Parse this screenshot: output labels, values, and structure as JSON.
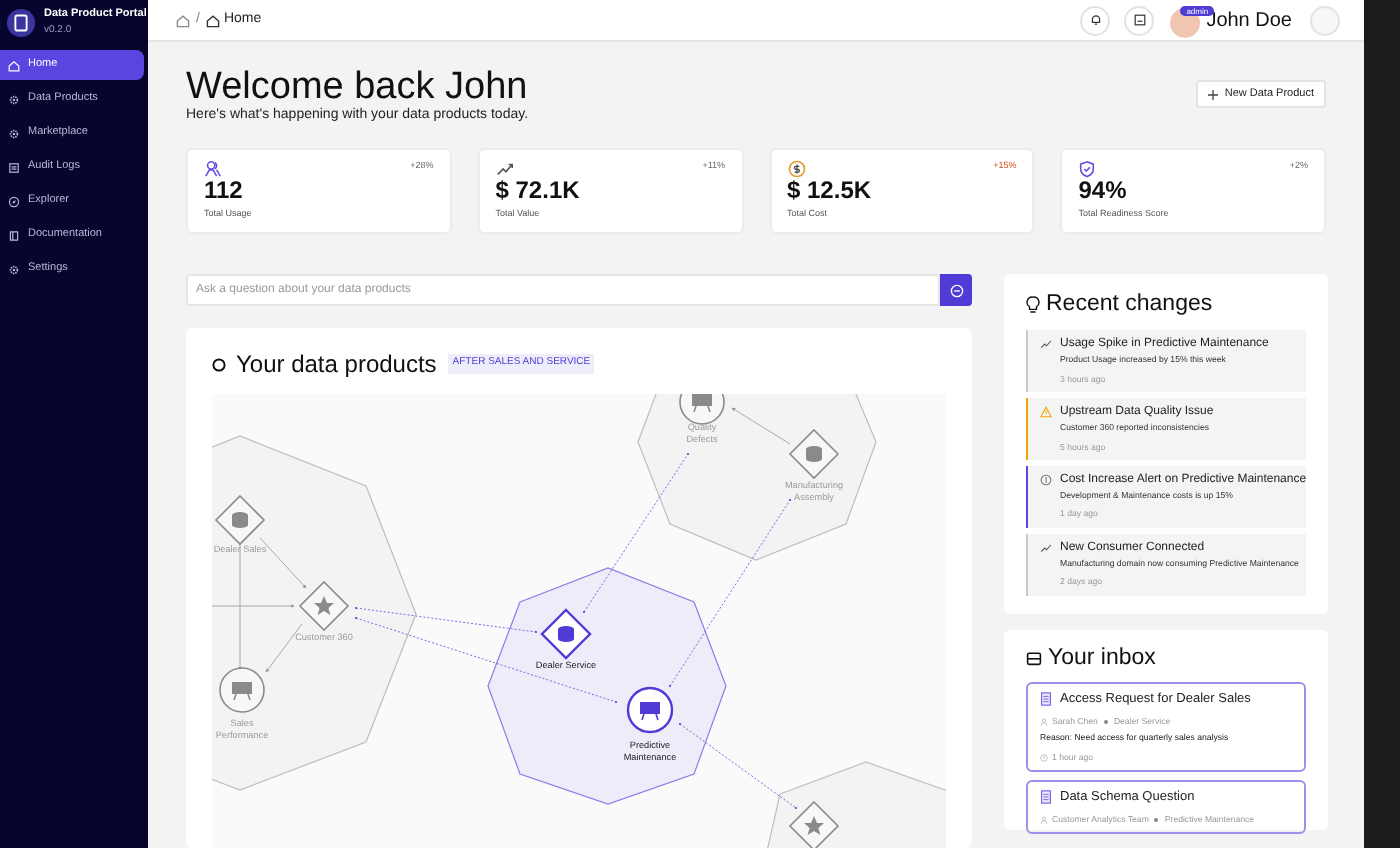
{
  "sidebar": {
    "brand": "Data Product Portal",
    "version": "v0.2.0",
    "items": [
      {
        "label": "Home",
        "selected": true
      },
      {
        "label": "Data Products",
        "selected": false
      },
      {
        "label": "Marketplace",
        "selected": false
      },
      {
        "label": "Audit Logs",
        "selected": false
      },
      {
        "label": "Explorer",
        "selected": false
      },
      {
        "label": "Documentation",
        "selected": false
      },
      {
        "label": "Settings",
        "selected": false
      }
    ]
  },
  "topbar": {
    "breadcrumb_separator": "/",
    "breadcrumb": "Home",
    "user": {
      "name": "John Doe",
      "role": "admin"
    }
  },
  "header": {
    "title": "Welcome back John",
    "subtitle": "Here's what's happening with your data products today.",
    "button": "New Data Product"
  },
  "stats": [
    {
      "kind": "usage",
      "value": "112",
      "label": "Total Usage",
      "change": "+28%"
    },
    {
      "kind": "value",
      "value": "$ 72.1K",
      "label": "Total Value",
      "change": "+11%"
    },
    {
      "kind": "cost",
      "value": "$ 12.5K",
      "label": "Total Cost",
      "change": "+15%"
    },
    {
      "kind": "readiness",
      "value": "94%",
      "label": "Total Readiness Score",
      "change": "+2%"
    }
  ],
  "search": {
    "placeholder": "Ask a question about your data products"
  },
  "products": {
    "title": "Your data products",
    "tag": "AFTER SALES AND SERVICE",
    "nodes": [
      {
        "label": "Quality Defects",
        "kind": "dashboard",
        "highlighted": false
      },
      {
        "label": "Manufacturing Assembly",
        "kind": "source",
        "highlighted": false
      },
      {
        "label": "Dealer Sales",
        "kind": "source",
        "highlighted": false
      },
      {
        "label": "Customer 360",
        "kind": "aggregate",
        "highlighted": false
      },
      {
        "label": "Sales Performance",
        "kind": "dashboard",
        "highlighted": false
      },
      {
        "label": "Dealer Service",
        "kind": "source",
        "highlighted": true
      },
      {
        "label": "Predictive Maintenance",
        "kind": "dashboard",
        "highlighted": true
      },
      {
        "kind": "aggregate",
        "highlighted": false
      }
    ]
  },
  "recent_changes": {
    "title": "Recent changes",
    "items": [
      {
        "kind": "trend",
        "title": "Usage Spike in Predictive Maintenance",
        "detail": "Product Usage increased by 15% this week",
        "time": "3 hours ago",
        "color": "#c9c9c9"
      },
      {
        "kind": "warning",
        "title": "Upstream Data Quality Issue",
        "detail": "Customer 360 reported inconsistencies",
        "time": "5 hours ago",
        "color": "#f0a500"
      },
      {
        "kind": "cost",
        "title": "Cost Increase Alert on Predictive Maintenance",
        "detail": "Development & Maintenance costs is up 15%",
        "time": "1 day ago",
        "color": "#5b45e0"
      },
      {
        "kind": "trend",
        "title": "New Consumer Connected",
        "detail": "Manufacturing domain now consuming Predictive Maintenance",
        "time": "2 days ago",
        "color": "#c9c9c9"
      }
    ]
  },
  "inbox": {
    "title": "Your inbox",
    "items": [
      {
        "title": "Access Request for Dealer Sales",
        "from": "Sarah Chen",
        "to": "Dealer Service",
        "reason": "Reason: Need access for quarterly sales analysis",
        "time": "1 hour ago"
      },
      {
        "title": "Data Schema Question",
        "from": "Customer Analytics Team",
        "to": "Predictive Maintenance"
      }
    ]
  }
}
